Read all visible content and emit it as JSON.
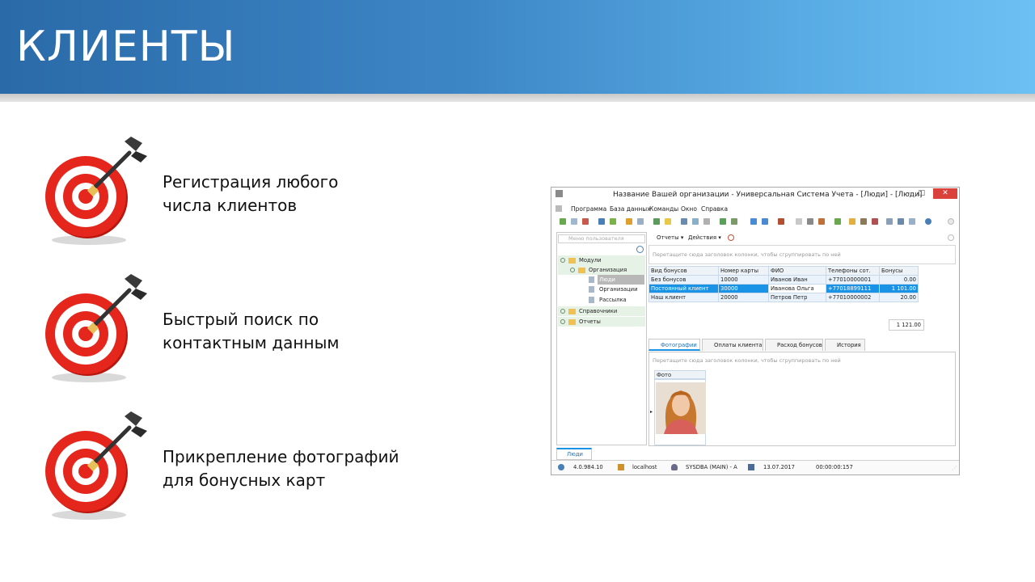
{
  "slide": {
    "title": "КЛИЕНТЫ",
    "features": [
      {
        "line1": "Регистрация любого",
        "line2": "числа клиентов"
      },
      {
        "line1": "Быстрый поиск по",
        "line2": "контактным данным"
      },
      {
        "line1": "Прикрепление фотографий",
        "line2": "для бонусных карт"
      }
    ]
  },
  "window": {
    "title": "Название Вашей организации - Универсальная Система Учета - [Люди] - [Люди]",
    "menu": [
      "Программа",
      "База данных",
      "Команды",
      "Окно",
      "Справка"
    ],
    "left_panel": {
      "search_placeholder": "Меню пользователя",
      "tree": [
        "Модули",
        "Организация",
        "Люди",
        "Организации",
        "Рассылка",
        "Справочники",
        "Отчеты"
      ]
    },
    "subtoolbar": {
      "reports": "Отчеты",
      "actions": "Действия"
    },
    "group_hint": "Перетащите сюда заголовок колонки, чтобы сгруппировать по ней",
    "grid": {
      "columns": [
        "Вид бонусов",
        "Номер карты",
        "ФИО",
        "Телефоны сот.",
        "Бонусы"
      ],
      "rows": [
        [
          "Без бонусов",
          "10000",
          "Иванов Иван",
          "+77010000001",
          "0.00"
        ],
        [
          "Постоянный клиент",
          "30000",
          "Иванова Ольга",
          "+77018899111",
          "1 101.00"
        ],
        [
          "Наш клиент",
          "20000",
          "Петров Петр",
          "+77010000002",
          "20.00"
        ]
      ],
      "total": "1 121.00"
    },
    "tabs": [
      "Фотографии",
      "Оплаты клиента",
      "Расход бонусов",
      "История"
    ],
    "photo_group_hint": "Перетащите сюда заголовок колонки, чтобы сгруппировать по ней",
    "photo_column": "Фото",
    "bottom_tab": "Люди",
    "status": {
      "version": "4.0.984.10",
      "server": "localhost",
      "user": "SYSDBA (MAIN) - A",
      "date": "13.07.2017",
      "time": "00:00:00:157"
    }
  },
  "colors": {
    "banner_start": "#2a6aa8",
    "banner_end": "#6cc0f2",
    "target_red": "#e4261c",
    "selection": "#1a93e6"
  }
}
